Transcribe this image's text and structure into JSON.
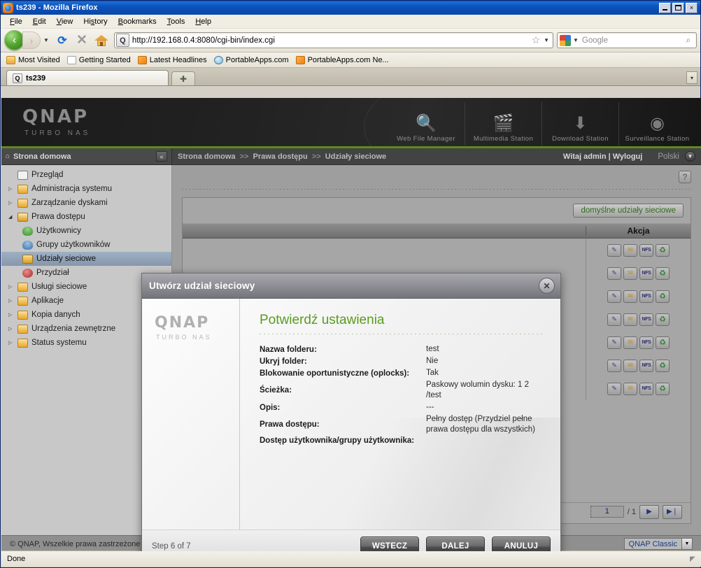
{
  "window": {
    "title": "ts239 - Mozilla Firefox",
    "favicon_glyph": "ⓠ",
    "minimize": "_",
    "maximize": "□",
    "close": "×"
  },
  "menubar": [
    {
      "label": "File"
    },
    {
      "label": "Edit"
    },
    {
      "label": "View"
    },
    {
      "label": "History"
    },
    {
      "label": "Bookmarks"
    },
    {
      "label": "Tools"
    },
    {
      "label": "Help"
    }
  ],
  "toolbar": {
    "back_glyph": "‹",
    "forward_glyph": "›",
    "dropdown_glyph": "▼",
    "reload_glyph": "⟳",
    "stop_glyph": "✕",
    "url_value": "http://192.168.0.4:8080/cgi-bin/index.cgi",
    "url_favicon": "Q",
    "star_glyph": "☆",
    "search_placeholder": "Google",
    "search_value": "",
    "search_mag": "⌕"
  },
  "bookmarks": [
    {
      "label": "Most Visited",
      "icon": "folder"
    },
    {
      "label": "Getting Started",
      "icon": "page"
    },
    {
      "label": "Latest Headlines",
      "icon": "rss"
    },
    {
      "label": "PortableApps.com",
      "icon": "pa"
    },
    {
      "label": "PortableApps.com Ne...",
      "icon": "rss"
    }
  ],
  "tabs": {
    "items": [
      {
        "label": "ts239",
        "favicon": "Q"
      }
    ],
    "newtab_glyph": "✚",
    "list_glyph": "▾"
  },
  "qnap": {
    "logo": "QNAP",
    "logo_sub": "TURBO NAS",
    "stations": [
      {
        "label": "Web File Manager",
        "icon": "🔍"
      },
      {
        "label": "Multimedia Station",
        "icon": "🎬"
      },
      {
        "label": "Download Station",
        "icon": "⬇"
      },
      {
        "label": "Surveillance Station",
        "icon": "◉"
      }
    ],
    "home_label": "Strona domowa",
    "home_icon": "⌂",
    "collapse_glyph": "«",
    "breadcrumb": [
      "Strona domowa",
      "Prawa dostępu",
      "Udziały sieciowe"
    ],
    "breadcrumb_sep": ">>",
    "welcome": "Witaj admin | Wyloguj",
    "language": "Polski",
    "language_caret": "▼",
    "help_glyph": "?",
    "footer_copyright": "© QNAP, Wszelkie prawa zastrzeżone",
    "theme_value": "QNAP Classic",
    "theme_caret": "▼"
  },
  "sidebar": {
    "items": [
      {
        "label": "Przegląd",
        "icon": "page",
        "arrow": "",
        "level": 0,
        "selected": false
      },
      {
        "label": "Administracja systemu",
        "icon": "folder",
        "arrow": "▷",
        "level": 0,
        "selected": false
      },
      {
        "label": "Zarządzanie dyskami",
        "icon": "folder",
        "arrow": "▷",
        "level": 0,
        "selected": false
      },
      {
        "label": "Prawa dostępu",
        "icon": "folderopen",
        "arrow": "◢",
        "level": 0,
        "selected": false
      },
      {
        "label": "Użytkownicy",
        "icon": "user",
        "arrow": "",
        "level": 1,
        "selected": false
      },
      {
        "label": "Grupy użytkowników",
        "icon": "group",
        "arrow": "",
        "level": 1,
        "selected": false
      },
      {
        "label": "Udziały sieciowe",
        "icon": "share",
        "arrow": "",
        "level": 1,
        "selected": true
      },
      {
        "label": "Przydział",
        "icon": "quota",
        "arrow": "",
        "level": 1,
        "selected": false
      },
      {
        "label": "Usługi sieciowe",
        "icon": "folder",
        "arrow": "▷",
        "level": 0,
        "selected": false
      },
      {
        "label": "Aplikacje",
        "icon": "folder",
        "arrow": "▷",
        "level": 0,
        "selected": false
      },
      {
        "label": "Kopia danych",
        "icon": "folder",
        "arrow": "▷",
        "level": 0,
        "selected": false
      },
      {
        "label": "Urządzenia zewnętrzne",
        "icon": "folder",
        "arrow": "▷",
        "level": 0,
        "selected": false
      },
      {
        "label": "Status systemu",
        "icon": "folder",
        "arrow": "▷",
        "level": 0,
        "selected": false
      }
    ]
  },
  "table": {
    "restore_button": "domyślne udziały sieciowe",
    "action_header": "Akcja",
    "row_count": 7,
    "row_actions": [
      {
        "name": "edit",
        "glyph": "✎"
      },
      {
        "name": "folder-permission",
        "glyph": "✉"
      },
      {
        "name": "nfs",
        "glyph": "NFS"
      },
      {
        "name": "refresh",
        "glyph": "♻"
      }
    ],
    "pager": {
      "page": "1",
      "total": "/ 1",
      "next": "▶",
      "last": "▶❘"
    }
  },
  "dialog": {
    "title": "Utwórz udział sieciowy",
    "close_glyph": "✕",
    "logo": "QNAP",
    "logo_sub": "TURBO NAS",
    "heading": "Potwierdź ustawienia",
    "settings": [
      {
        "key": "Nazwa folderu:",
        "value": "test"
      },
      {
        "key": "Ukryj folder:",
        "value": "Nie"
      },
      {
        "key": "Blokowanie oportunistyczne (oplocks):",
        "value": "Tak"
      },
      {
        "key": "Ścieżka:",
        "value": "Paskowy wolumin dysku: 1 2 /test"
      },
      {
        "key": "Opis:",
        "value": "---"
      },
      {
        "key": "Prawa dostępu:",
        "value": "Pełny dostęp (Przydziel pełne prawa dostępu dla wszystkich)"
      },
      {
        "key": "Dostęp użytkownika/grupy użytkownika:",
        "value": ""
      }
    ],
    "step": "Step 6 of 7",
    "buttons": [
      {
        "label": "WSTECZ",
        "name": "back-button"
      },
      {
        "label": "DALEJ",
        "name": "next-button"
      },
      {
        "label": "ANULUJ",
        "name": "cancel-button"
      }
    ]
  },
  "statusbar": {
    "text": "Done"
  }
}
